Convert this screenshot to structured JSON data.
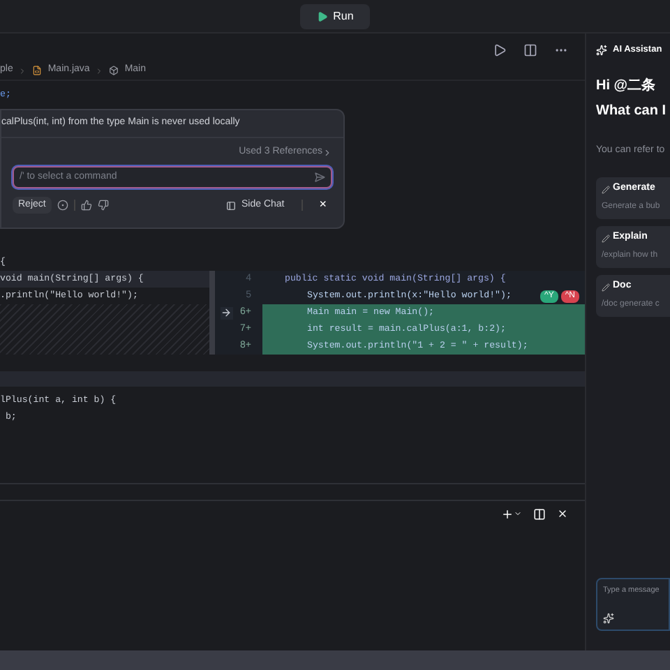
{
  "toolbar": {
    "run_button": "Run"
  },
  "breadcrumb": [
    "ple",
    "Main.java",
    "Main"
  ],
  "code_top": [
    {
      "text": "e;",
      "color": "#6b9cf0"
    }
  ],
  "inline_chat": {
    "warning": "calPlus(int, int) from the type Main is never used locally",
    "references": "Used 3 References",
    "placeholder": "/' to select a command",
    "reject": "Reject",
    "side_chat": "Side Chat",
    "close": "×"
  },
  "code_mid": [
    {
      "text": "{",
      "color": "#c8ccd4"
    }
  ],
  "diff": {
    "left": [
      {
        "text": "void main(String[] args) {",
        "highlighted": true
      },
      {
        "text": ".println(\"Hello world!\");",
        "highlighted": false
      }
    ],
    "right": [
      {
        "number": "4",
        "text": "public static void main(String[] args) {",
        "kind": "signature",
        "added": false,
        "current": false
      },
      {
        "number": "5",
        "text": "System.out.println(x:\"Hello world!\");",
        "kind": "statement",
        "added": false,
        "current": false
      },
      {
        "number": "6+",
        "text": "Main main = new Main();",
        "kind": "statement",
        "added": true,
        "current": true
      },
      {
        "number": "7+",
        "text": "int result = main.calPlus(a:1, b:2);",
        "kind": "statement",
        "added": true,
        "current": false
      },
      {
        "number": "8+",
        "text": "System.out.println(\"1 + 2 = \" + result);",
        "kind": "statement",
        "added": true,
        "current": false
      }
    ],
    "accept": "^Y",
    "discard": "^N"
  },
  "code_bottom": [
    {
      "text": "lPlus(int a, int b) {",
      "color": "#c8ccd4"
    },
    {
      "text": " b;",
      "color": "#c8ccd4"
    }
  ],
  "assistant": {
    "title": "AI Assistan",
    "greeting": "Hi @二条",
    "question": "What can I",
    "hint": "You can refer to",
    "cards": [
      {
        "title": "Generate",
        "text": "Generate a bub"
      },
      {
        "title": "Explain",
        "text": "/explain how th"
      },
      {
        "title": "Doc",
        "text": "/doc generate c"
      }
    ],
    "placeholder": "Type a message"
  }
}
